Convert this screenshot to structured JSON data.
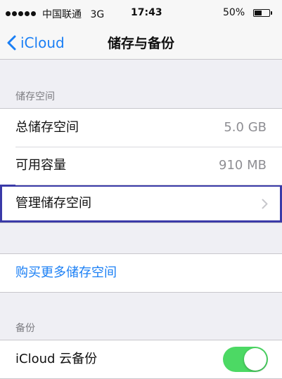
{
  "status_bar": {
    "carrier": "中国联通",
    "network": "3G",
    "time": "17:43",
    "battery_text": "50%",
    "battery_level": 0.5,
    "signal_bars": 5,
    "signal_icon": "signal-dots-icon",
    "battery_icon": "battery-icon"
  },
  "nav": {
    "back_label": "iCloud",
    "back_icon": "chevron-left-icon",
    "title": "储存与备份"
  },
  "storage_section": {
    "header": "储存空间",
    "rows": [
      {
        "label": "总储存空间",
        "value": "5.0 GB"
      },
      {
        "label": "可用容量",
        "value": "910 MB"
      },
      {
        "label": "管理储存空间",
        "chevron_icon": "chevron-right-icon"
      }
    ]
  },
  "purchase": {
    "label": "购买更多储存空间"
  },
  "backup_section": {
    "header": "备份",
    "icloud_backup_label": "iCloud 云备份",
    "icloud_backup_enabled": true
  },
  "colors": {
    "accent_blue": "#1a7ff5",
    "toggle_green": "#4cd964",
    "highlight_border": "#3a3aa8",
    "background": "#efeff4",
    "secondary_text": "#8e8e93"
  }
}
